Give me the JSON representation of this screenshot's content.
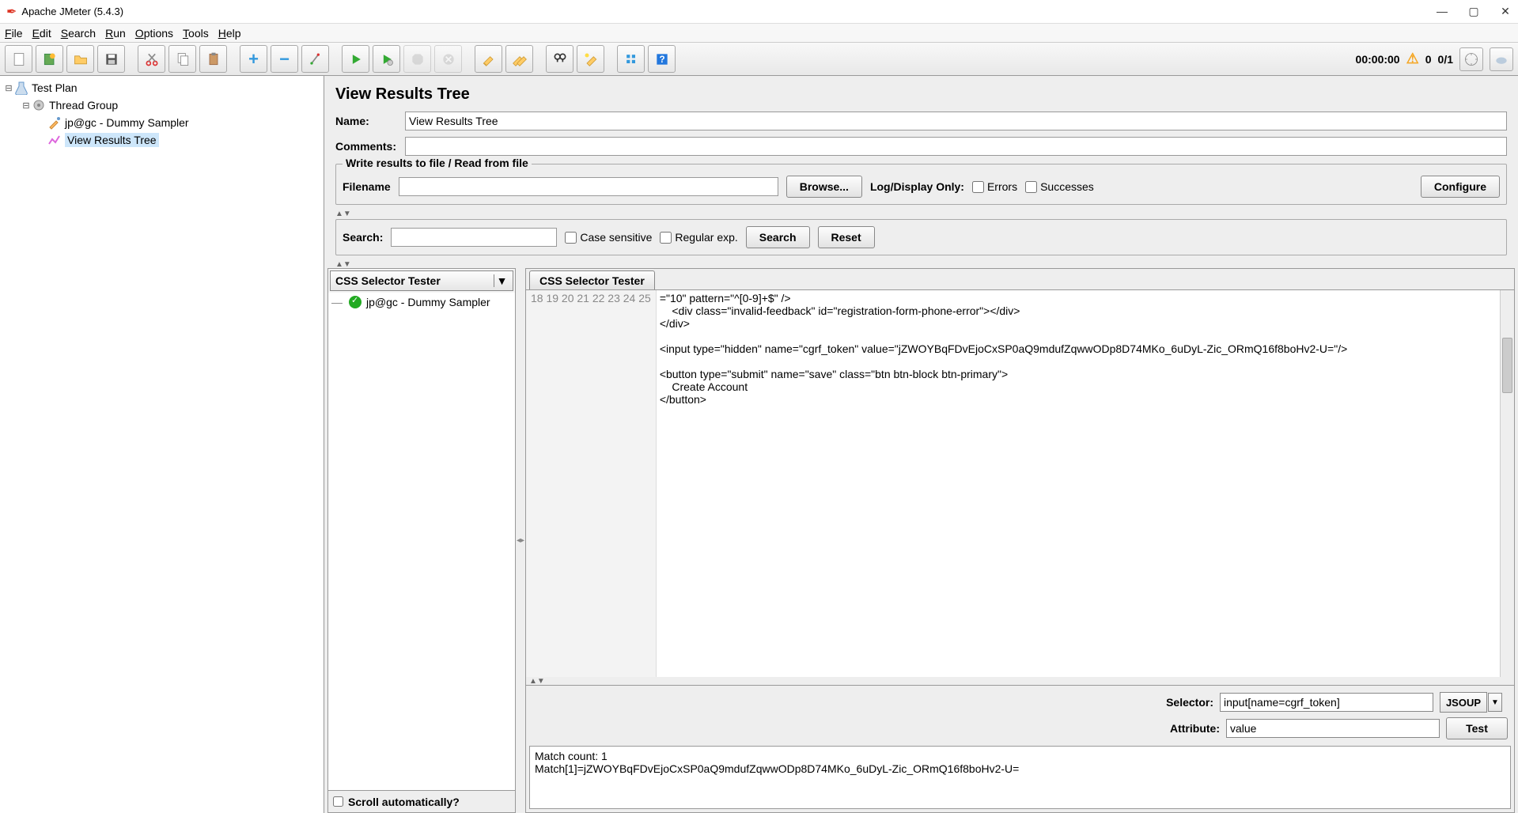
{
  "window": {
    "title": "Apache JMeter (5.4.3)"
  },
  "menubar": [
    "File",
    "Edit",
    "Search",
    "Run",
    "Options",
    "Tools",
    "Help"
  ],
  "toolbar_right": {
    "time": "00:00:00",
    "warn_count": "0",
    "threads": "0/1"
  },
  "tree": {
    "root": "Test Plan",
    "group": "Thread Group",
    "sampler": "jp@gc - Dummy Sampler",
    "listener": "View Results Tree"
  },
  "panel": {
    "heading": "View Results Tree",
    "name_label": "Name:",
    "name_value": "View Results Tree",
    "comments_label": "Comments:",
    "comments_value": ""
  },
  "file_box": {
    "legend": "Write results to file / Read from file",
    "filename_label": "Filename",
    "filename_value": "",
    "browse": "Browse...",
    "logonly": "Log/Display Only:",
    "errors": "Errors",
    "successes": "Successes",
    "configure": "Configure"
  },
  "search_box": {
    "label": "Search:",
    "value": "",
    "case": "Case sensitive",
    "regex": "Regular exp.",
    "search_btn": "Search",
    "reset_btn": "Reset"
  },
  "results": {
    "renderer": "CSS Selector Tester",
    "sample_name": "jp@gc - Dummy Sampler",
    "scroll_auto": "Scroll automatically?",
    "tab": "CSS Selector Tester",
    "code_lines": [
      "=\"10\" pattern=\"^[0-9]+$\" />",
      "    <div class=\"invalid-feedback\" id=\"registration-form-phone-error\"></div>",
      "</div>",
      "",
      "<input type=\"hidden\" name=\"cgrf_token\" value=\"jZWOYBqFDvEjoCxSP0aQ9mdufZqwwODp8D74MKo_6uDyL-Zic_ORmQ16f8boHv2-U=\"/>",
      "",
      "<button type=\"submit\" name=\"save\" class=\"btn btn-block btn-primary\">",
      "    Create Account",
      "</button>"
    ],
    "first_line_no": 18
  },
  "selector": {
    "selector_label": "Selector:",
    "selector_value": "input[name=cgrf_token]",
    "engine": "JSOUP",
    "attribute_label": "Attribute:",
    "attribute_value": "value",
    "test_btn": "Test"
  },
  "match": {
    "count_line": "Match count: 1",
    "result_line": "Match[1]=jZWOYBqFDvEjoCxSP0aQ9mdufZqwwODp8D74MKo_6uDyL-Zic_ORmQ16f8boHv2-U="
  }
}
